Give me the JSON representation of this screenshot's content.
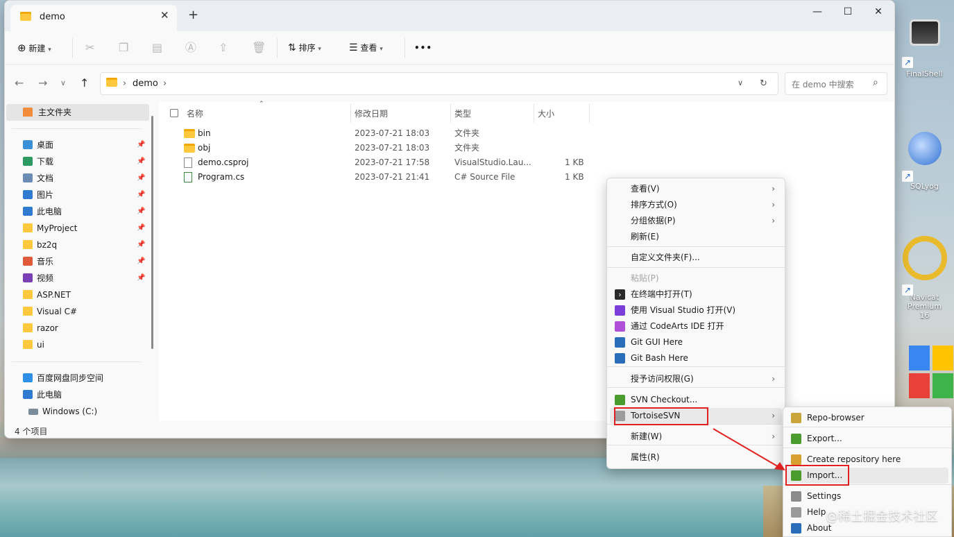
{
  "window": {
    "tab_title": "demo",
    "minimize": "—",
    "maximize": "☐",
    "close": "✕",
    "tab_close": "✕",
    "new_tab": "+"
  },
  "toolbar": {
    "new_label": "新建",
    "sort_label": "排序",
    "view_label": "查看",
    "more": "•••",
    "icons": [
      "cut-icon",
      "copy-icon",
      "paste-icon",
      "rename-icon",
      "share-icon",
      "delete-icon"
    ]
  },
  "address": {
    "crumbs": [
      "demo"
    ],
    "search_placeholder": "在 demo 中搜索"
  },
  "sidebar": {
    "home": "主文件夹",
    "quick": [
      {
        "label": "桌面",
        "color": "#3a8fd9"
      },
      {
        "label": "下载",
        "color": "#2c9b63"
      },
      {
        "label": "文档",
        "color": "#6a8cb5"
      },
      {
        "label": "图片",
        "color": "#2f7bd1"
      },
      {
        "label": "此电脑",
        "color": "#2f7bd1"
      },
      {
        "label": "MyProject",
        "color": "#ffc83d"
      },
      {
        "label": "bz2q",
        "color": "#ffc83d"
      },
      {
        "label": "音乐",
        "color": "#e05a3c"
      },
      {
        "label": "视频",
        "color": "#7b3fb8"
      },
      {
        "label": "ASP.NET",
        "color": "#ffc83d"
      },
      {
        "label": "Visual C#",
        "color": "#ffc83d"
      },
      {
        "label": "razor",
        "color": "#ffc83d"
      },
      {
        "label": "ui",
        "color": "#ffc83d"
      }
    ],
    "bottom": [
      "百度网盘同步空间",
      "此电脑",
      "Windows (C:)"
    ]
  },
  "columns": {
    "name": "名称",
    "modified": "修改日期",
    "type": "类型",
    "size": "大小"
  },
  "files": [
    {
      "name": "bin",
      "modified": "2023-07-21 18:03",
      "type": "文件夹",
      "size": "",
      "kind": "folder"
    },
    {
      "name": "obj",
      "modified": "2023-07-21 18:03",
      "type": "文件夹",
      "size": "",
      "kind": "folder"
    },
    {
      "name": "demo.csproj",
      "modified": "2023-07-21 17:58",
      "type": "VisualStudio.Lau...",
      "size": "1 KB",
      "kind": "file"
    },
    {
      "name": "Program.cs",
      "modified": "2023-07-21 21:41",
      "type": "C# Source File",
      "size": "1 KB",
      "kind": "cs"
    }
  ],
  "status": {
    "count": "4 个项目"
  },
  "context_menu": [
    {
      "label": "查看(V)",
      "sub": true
    },
    {
      "label": "排序方式(O)",
      "sub": true
    },
    {
      "label": "分组依据(P)",
      "sub": true
    },
    {
      "label": "刷新(E)",
      "sub": false
    },
    {
      "label": "自定义文件夹(F)...",
      "sub": false
    },
    {
      "label": "粘贴(P)",
      "sub": false,
      "disabled": true
    },
    {
      "label": "在终端中打开(T)",
      "sub": false
    },
    {
      "label": "使用 Visual Studio 打开(V)",
      "sub": false
    },
    {
      "label": "通过 CodeArts IDE 打开",
      "sub": false
    },
    {
      "label": "Git GUI Here",
      "sub": false
    },
    {
      "label": "Git Bash Here",
      "sub": false
    },
    {
      "label": "授予访问权限(G)",
      "sub": true
    },
    {
      "label": "SVN Checkout...",
      "sub": false
    },
    {
      "label": "TortoiseSVN",
      "sub": true
    },
    {
      "label": "新建(W)",
      "sub": true
    },
    {
      "label": "属性(R)",
      "sub": false
    }
  ],
  "svn_menu": [
    {
      "label": "Repo-browser"
    },
    {
      "label": "Export..."
    },
    {
      "label": "Create repository here"
    },
    {
      "label": "Import..."
    },
    {
      "label": "Settings"
    },
    {
      "label": "Help"
    },
    {
      "label": "About"
    }
  ],
  "desktop": {
    "icons": [
      "FinalShell",
      "SQLyog",
      "Navicat Premium",
      "16"
    ]
  },
  "watermark": "@稀土掘金技术社区"
}
